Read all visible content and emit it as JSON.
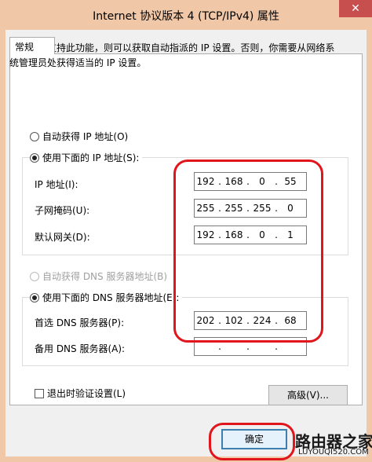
{
  "window": {
    "title": "Internet 协议版本 4 (TCP/IPv4) 属性",
    "close_glyph": "✕"
  },
  "tab": {
    "label": "常规"
  },
  "description": "如果网络支持此功能，则可以获取自动指派的 IP 设置。否则，你需要从网络系统管理员处获得适当的 IP 设置。",
  "ip_mode": {
    "auto_label": "自动获得 IP 地址(O)",
    "manual_label": "使用下面的 IP 地址(S):",
    "selected": "manual"
  },
  "ip_fields": [
    {
      "label": "IP 地址(I):",
      "octets": [
        "192",
        "168",
        "0",
        "55"
      ]
    },
    {
      "label": "子网掩码(U):",
      "octets": [
        "255",
        "255",
        "255",
        "0"
      ]
    },
    {
      "label": "默认网关(D):",
      "octets": [
        "192",
        "168",
        "0",
        "1"
      ]
    }
  ],
  "dns_mode": {
    "auto_label": "自动获得 DNS 服务器地址(B)",
    "manual_label": "使用下面的 DNS 服务器地址(E):",
    "selected": "manual",
    "auto_disabled": true
  },
  "dns_fields": [
    {
      "label": "首选 DNS 服务器(P):",
      "octets": [
        "202",
        "102",
        "224",
        "68"
      ]
    },
    {
      "label": "备用 DNS 服务器(A):",
      "octets": [
        "",
        "",
        "",
        ""
      ]
    }
  ],
  "validate": {
    "label": "退出时验证设置(L)",
    "checked": false
  },
  "buttons": {
    "advanced": "高级(V)...",
    "ok": "确定"
  },
  "watermark": {
    "logo": "路由器之家",
    "url": "LUYOUQI520.COM"
  },
  "colors": {
    "title_bar": "#f0c8a8",
    "close_button": "#c7504f",
    "highlight": "#e0161c"
  }
}
